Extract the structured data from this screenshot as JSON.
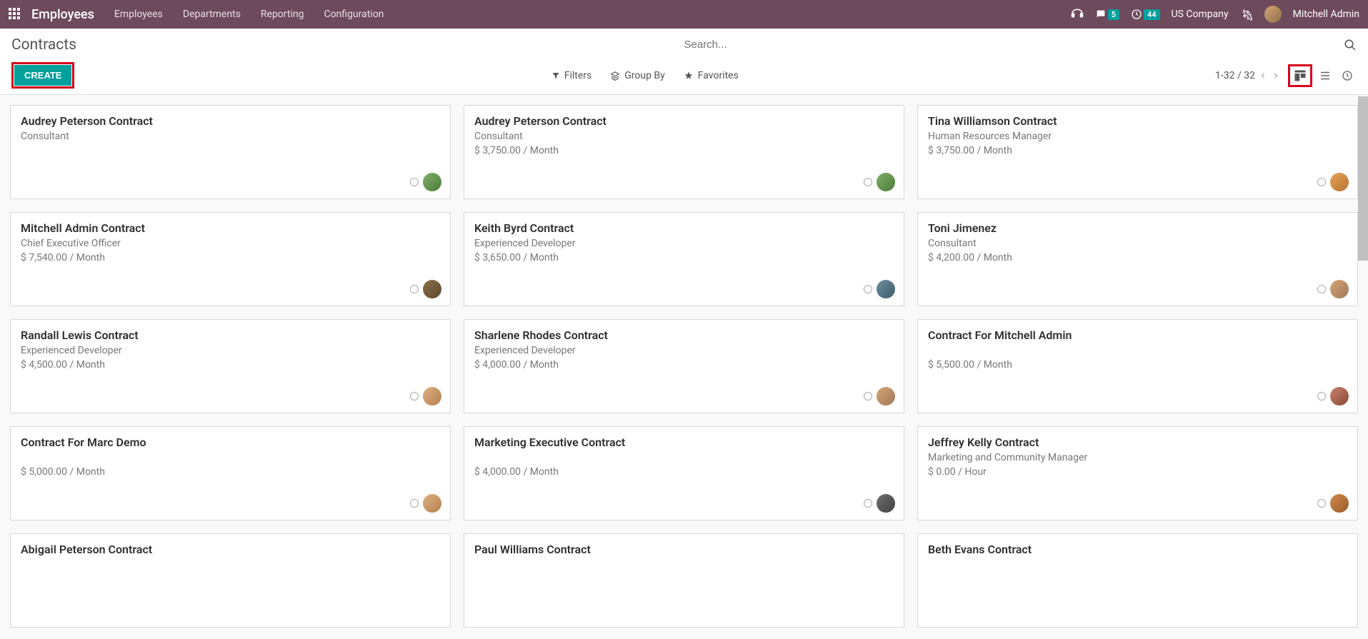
{
  "header": {
    "brand": "Employees",
    "menu": [
      "Employees",
      "Departments",
      "Reporting",
      "Configuration"
    ],
    "conversations_badge": "5",
    "activities_badge": "44",
    "company": "US Company",
    "user": "Mitchell Admin"
  },
  "control": {
    "breadcrumb": "Contracts",
    "create_label": "CREATE",
    "search_placeholder": "Search...",
    "filters_label": "Filters",
    "groupby_label": "Group By",
    "favorites_label": "Favorites",
    "pager": "1-32 / 32"
  },
  "cards": [
    {
      "title": "Audrey Peterson Contract",
      "sub": "Consultant",
      "wage": "",
      "av": "c1"
    },
    {
      "title": "Audrey Peterson Contract",
      "sub": "Consultant",
      "wage": "$ 3,750.00 / Month",
      "av": "c1"
    },
    {
      "title": "Tina Williamson Contract",
      "sub": "Human Resources Manager",
      "wage": "$ 3,750.00 / Month",
      "av": "c2"
    },
    {
      "title": "Mitchell Admin Contract",
      "sub": "Chief Executive Officer",
      "wage": "$ 7,540.00 / Month",
      "av": "c3"
    },
    {
      "title": "Keith Byrd Contract",
      "sub": "Experienced Developer",
      "wage": "$ 3,650.00 / Month",
      "av": "c5"
    },
    {
      "title": "Toni Jimenez",
      "sub": "Consultant",
      "wage": "$ 4,200.00 / Month",
      "av": "c4"
    },
    {
      "title": "Randall Lewis Contract",
      "sub": "Experienced Developer",
      "wage": "$ 4,500.00 / Month",
      "av": "c9"
    },
    {
      "title": "Sharlene Rhodes Contract",
      "sub": "Experienced Developer",
      "wage": "$ 4,000.00 / Month",
      "av": "c4"
    },
    {
      "title": "Contract For Mitchell Admin",
      "sub": "",
      "wage": "$ 5,500.00 / Month",
      "av": "c6"
    },
    {
      "title": "Contract For Marc Demo",
      "sub": "",
      "wage": "$ 5,000.00 / Month",
      "av": "c9"
    },
    {
      "title": "Marketing Executive Contract",
      "sub": "",
      "wage": "$ 4,000.00 / Month",
      "av": "c10"
    },
    {
      "title": "Jeffrey Kelly Contract",
      "sub": "Marketing and Community Manager",
      "wage": "$ 0.00 / Hour",
      "av": "c11"
    },
    {
      "title": "Abigail Peterson Contract",
      "sub": "",
      "wage": "",
      "av": ""
    },
    {
      "title": "Paul Williams Contract",
      "sub": "",
      "wage": "",
      "av": ""
    },
    {
      "title": "Beth Evans Contract",
      "sub": "",
      "wage": "",
      "av": ""
    }
  ]
}
